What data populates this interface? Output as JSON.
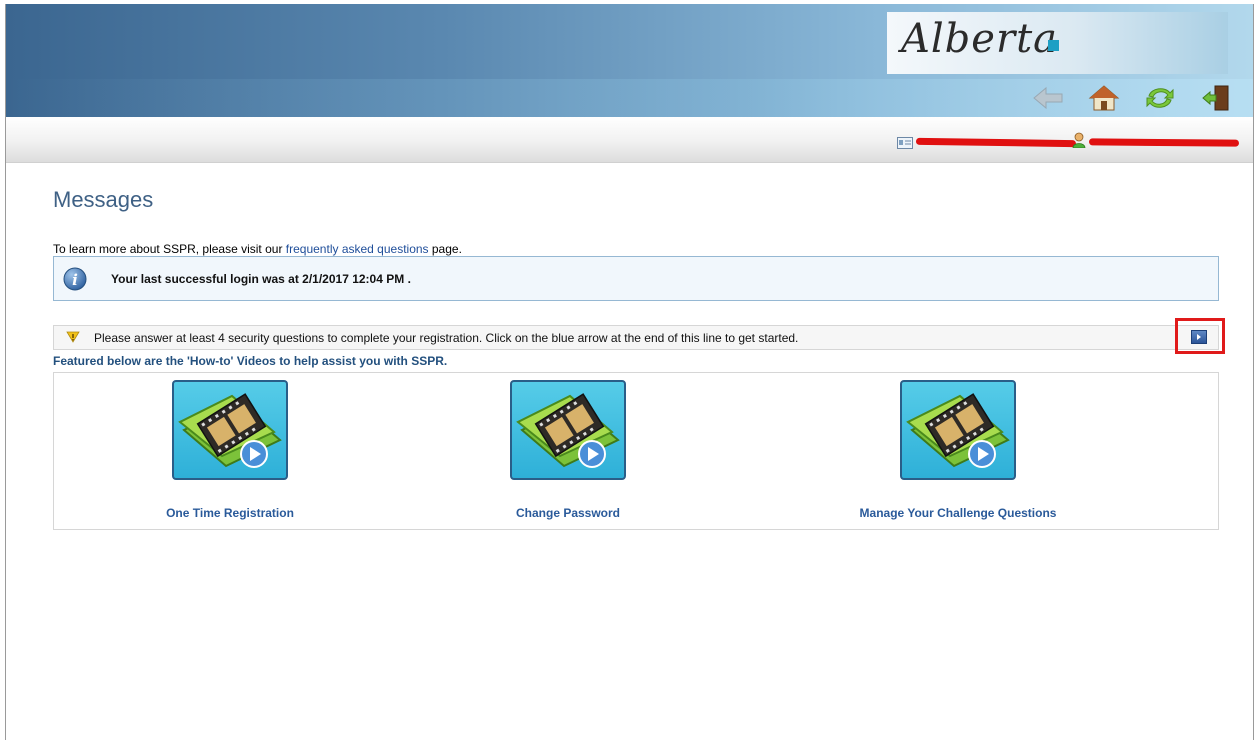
{
  "header": {
    "logo_text": "Alberta",
    "nav": [
      {
        "name": "back",
        "icon": "back-arrow-icon"
      },
      {
        "name": "home",
        "icon": "home-icon"
      },
      {
        "name": "refresh",
        "icon": "refresh-icon"
      },
      {
        "name": "logout",
        "icon": "logout-door-icon"
      }
    ]
  },
  "userbar": {
    "card_icon": "id-card-icon",
    "person_icon": "user-icon"
  },
  "page": {
    "title": "Messages",
    "faq_prefix": "To learn more about SSPR, please visit our ",
    "faq_link": "frequently asked questions",
    "faq_suffix": " page.",
    "login_message": "Your last successful login was at 2/1/2017 12:04 PM .",
    "warning_message": "Please answer at least 4 security questions to complete your registration. Click on the blue arrow at the end of this line to get started.",
    "featured_text": "Featured below are the 'How-to' Videos to help assist you with SSPR."
  },
  "videos": [
    {
      "label": "One Time Registration",
      "icon": "video-folder-icon"
    },
    {
      "label": "Change Password",
      "icon": "video-folder-icon"
    },
    {
      "label": "Manage Your Challenge Questions",
      "icon": "video-folder-icon"
    }
  ],
  "colors": {
    "title": "#3f6185",
    "link": "#1f4e9a",
    "highlight_frame": "#e01a1a",
    "banner_start": "#3b6690",
    "banner_end": "#b2d8ec"
  }
}
